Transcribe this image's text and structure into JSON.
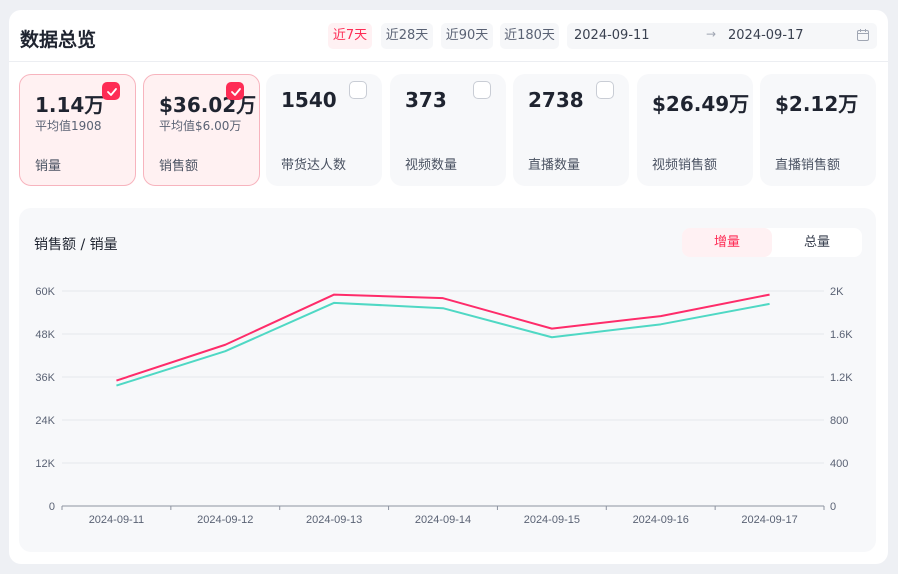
{
  "header": {
    "title": "数据总览",
    "ranges": [
      {
        "label": "近7天",
        "active": true
      },
      {
        "label": "近28天",
        "active": false
      },
      {
        "label": "近90天",
        "active": false
      },
      {
        "label": "近180天",
        "active": false
      }
    ],
    "date_start": "2024-09-11",
    "date_arrow": "→",
    "date_end": "2024-09-17"
  },
  "metrics": [
    {
      "value": "1.14万",
      "avg": "平均值1908",
      "label": "销量",
      "selected": true
    },
    {
      "value": "$36.02万",
      "avg": "平均值$6.00万",
      "label": "销售额",
      "selected": true
    },
    {
      "value": "1540",
      "avg": "",
      "label": "带货达人数",
      "selected": false
    },
    {
      "value": "373",
      "avg": "",
      "label": "视频数量",
      "selected": false
    },
    {
      "value": "2738",
      "avg": "",
      "label": "直播数量",
      "selected": false
    },
    {
      "value": "$26.49万",
      "avg": "",
      "label": "视频销售额",
      "selected": false
    },
    {
      "value": "$2.12万",
      "avg": "",
      "label": "直播销售额",
      "selected": false
    }
  ],
  "chart_panel": {
    "title": "销售额 / 销量",
    "toggle": [
      {
        "label": "增量",
        "active": true
      },
      {
        "label": "总量",
        "active": false
      }
    ]
  },
  "colors": {
    "accent": "#fe2c55",
    "series_sales_amount": "#fe2c6a",
    "series_sales_volume": "#4fd8c4",
    "selected_card_bg": "#fff1f2"
  },
  "chart_data": {
    "type": "line",
    "x": [
      "2024-09-11",
      "2024-09-12",
      "2024-09-13",
      "2024-09-14",
      "2024-09-15",
      "2024-09-16",
      "2024-09-17"
    ],
    "left_axis": {
      "ylim": [
        0,
        60000
      ],
      "ticks": [
        "0",
        "12K",
        "24K",
        "36K",
        "48K",
        "60K"
      ]
    },
    "right_axis": {
      "ylim": [
        0,
        2000
      ],
      "ticks": [
        "0",
        "400",
        "800",
        "1.2K",
        "1.6K",
        "2K"
      ]
    },
    "series": [
      {
        "axis": "left",
        "color": "#fe2c6a",
        "values": [
          35000,
          45000,
          59000,
          58000,
          49500,
          53000,
          59000
        ]
      },
      {
        "axis": "right",
        "color": "#4fd8c4",
        "values": [
          1120,
          1440,
          1890,
          1840,
          1570,
          1690,
          1880
        ]
      }
    ],
    "grid": true,
    "legend": "none"
  }
}
